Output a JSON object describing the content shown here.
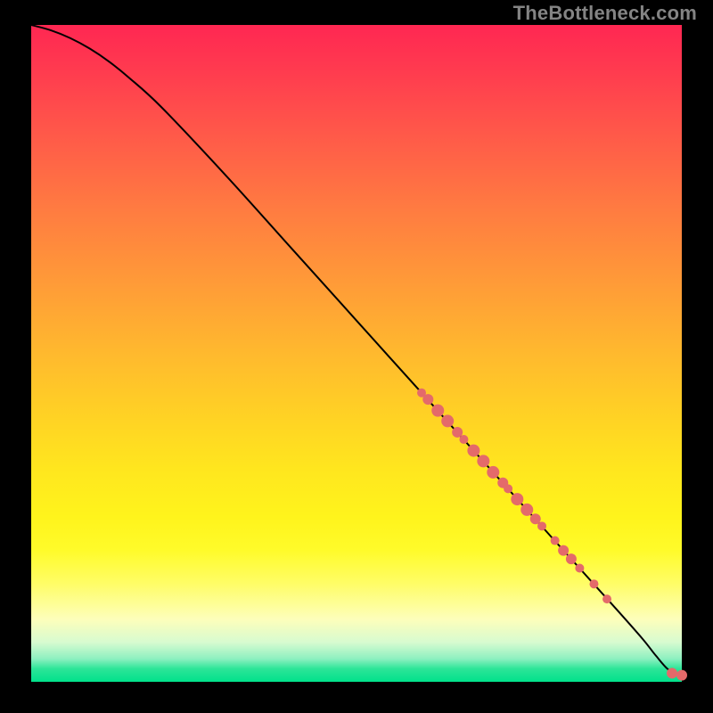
{
  "attribution": "TheBottleneck.com",
  "chart_data": {
    "type": "line",
    "title": "",
    "xlabel": "",
    "ylabel": "",
    "xlim": [
      0,
      100
    ],
    "ylim": [
      0,
      100
    ],
    "grid": false,
    "legend": false,
    "background_gradient": {
      "orientation": "vertical",
      "stops": [
        {
          "pos": 0.0,
          "color": "#ff2752"
        },
        {
          "pos": 0.07,
          "color": "#ff3b4f"
        },
        {
          "pos": 0.17,
          "color": "#ff5a49"
        },
        {
          "pos": 0.28,
          "color": "#ff7b41"
        },
        {
          "pos": 0.39,
          "color": "#ff9a38"
        },
        {
          "pos": 0.5,
          "color": "#ffb92e"
        },
        {
          "pos": 0.6,
          "color": "#ffd324"
        },
        {
          "pos": 0.68,
          "color": "#ffe71e"
        },
        {
          "pos": 0.75,
          "color": "#fff41c"
        },
        {
          "pos": 0.8,
          "color": "#fffb2a"
        },
        {
          "pos": 0.85,
          "color": "#fffd66"
        },
        {
          "pos": 0.905,
          "color": "#fdfebb"
        },
        {
          "pos": 0.94,
          "color": "#d7fbd0"
        },
        {
          "pos": 0.965,
          "color": "#8df0c0"
        },
        {
          "pos": 0.98,
          "color": "#2de598"
        },
        {
          "pos": 1.0,
          "color": "#00e18b"
        }
      ]
    },
    "series": [
      {
        "name": "bottleneck-curve",
        "type": "line",
        "color": "#000000",
        "x": [
          0,
          3,
          6,
          9,
          12,
          15,
          20,
          30,
          40,
          50,
          60,
          70,
          80,
          90,
          94,
          96,
          98,
          100
        ],
        "y": [
          100,
          99.2,
          98.0,
          96.4,
          94.4,
          92.0,
          87.5,
          77.0,
          66.0,
          55.0,
          44.0,
          33.0,
          22.0,
          11.0,
          6.5,
          4.0,
          1.8,
          1.0
        ]
      },
      {
        "name": "highlighted-points",
        "type": "scatter",
        "color": "#e46a6a",
        "points": [
          {
            "x": 60.0,
            "y": 44.0,
            "r": 5
          },
          {
            "x": 61.0,
            "y": 43.0,
            "r": 6
          },
          {
            "x": 62.5,
            "y": 41.3,
            "r": 7
          },
          {
            "x": 64.0,
            "y": 39.7,
            "r": 7
          },
          {
            "x": 65.5,
            "y": 38.0,
            "r": 6
          },
          {
            "x": 66.5,
            "y": 36.9,
            "r": 5
          },
          {
            "x": 68.0,
            "y": 35.2,
            "r": 7
          },
          {
            "x": 69.5,
            "y": 33.6,
            "r": 7
          },
          {
            "x": 71.0,
            "y": 31.9,
            "r": 7
          },
          {
            "x": 72.5,
            "y": 30.3,
            "r": 6
          },
          {
            "x": 73.3,
            "y": 29.4,
            "r": 5
          },
          {
            "x": 74.7,
            "y": 27.8,
            "r": 7
          },
          {
            "x": 76.2,
            "y": 26.2,
            "r": 7
          },
          {
            "x": 77.5,
            "y": 24.8,
            "r": 6
          },
          {
            "x": 78.5,
            "y": 23.7,
            "r": 5
          },
          {
            "x": 80.5,
            "y": 21.5,
            "r": 5
          },
          {
            "x": 81.8,
            "y": 20.0,
            "r": 6
          },
          {
            "x": 83.0,
            "y": 18.7,
            "r": 6
          },
          {
            "x": 84.3,
            "y": 17.3,
            "r": 5
          },
          {
            "x": 86.5,
            "y": 14.9,
            "r": 5
          },
          {
            "x": 88.5,
            "y": 12.6,
            "r": 5
          },
          {
            "x": 98.5,
            "y": 1.3,
            "r": 6
          },
          {
            "x": 100.0,
            "y": 1.0,
            "r": 6
          }
        ]
      }
    ]
  },
  "colors": {
    "background": "#000000",
    "attribution": "#848484",
    "curve": "#000000",
    "point": "#e46a6a"
  }
}
